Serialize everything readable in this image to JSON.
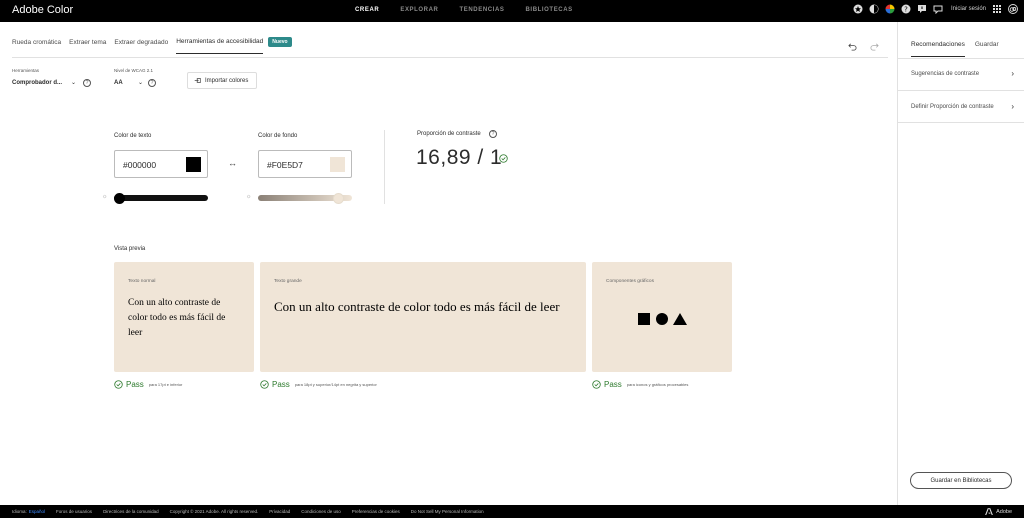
{
  "app": {
    "title": "Adobe Color"
  },
  "topnav": {
    "items": [
      "CREAR",
      "EXPLORAR",
      "TENDENCIAS",
      "BIBLIOTECAS"
    ]
  },
  "topbar_right": {
    "signin": "Iniciar sesión"
  },
  "subtabs": {
    "items": [
      "Rueda cromática",
      "Extraer tema",
      "Extraer degradado",
      "Herramientas de accesibilidad"
    ],
    "badge": "Nuevo"
  },
  "controls": {
    "tool_label": "Herramientas",
    "tool_value": "Comprobador d...",
    "wcag_label": "Nivel de WCAG 2.1",
    "wcag_value": "AA",
    "import_label": "Importar colores"
  },
  "contrast": {
    "text_color_label": "Color de texto",
    "text_color_value": "#000000",
    "background_label": "Color de fondo",
    "background_value": "#F0E5D7",
    "ratio_label": "Proporción de contraste",
    "ratio_value": "16,89 / 1",
    "text_slider_level": 0.0,
    "background_slider_level": 0.9
  },
  "preview": {
    "label": "Vista previa",
    "cards": [
      {
        "title": "Texto normal",
        "text": "Con un alto contraste de color todo es más fácil de leer",
        "pass": "Pass",
        "note": "para 17pt e inferior"
      },
      {
        "title": "Texto grande",
        "text": "Con un alto contraste de color todo es más fácil de leer",
        "pass": "Pass",
        "note": "para 18pt y superior/14pt en negrita y superior"
      },
      {
        "title": "Componentes gráficos",
        "pass": "Pass",
        "note": "para iconos y gráficos procesables"
      }
    ]
  },
  "right_panel": {
    "tabs": [
      "Recomendaciones",
      "Guardar"
    ],
    "items": [
      "Sugerencias de contraste",
      "Definir Proporción de contraste"
    ],
    "save_button": "Guardar en Bibliotecas"
  },
  "footer": {
    "language_label": "Idioma:",
    "language_value": "Español",
    "links": [
      "Foros de usuarios",
      "Directrices de la comunidad",
      "Copyright © 2021 Adobe. All rights reserved.",
      "Privacidad",
      "Condiciones de uso",
      "Preferencias de cookies",
      "Do Not Sell My Personal Information"
    ],
    "brand": "Adobe"
  },
  "colors": {
    "text": "#000000",
    "background": "#F0E5D7",
    "accent": "#2d8a8a",
    "pass": "#2d7a2d"
  },
  "icons": [
    "undo-icon",
    "redo-icon",
    "help-icon",
    "import-icon",
    "swap-icon",
    "check-circle-icon",
    "square-icon",
    "circle-icon",
    "triangle-icon",
    "chevron-right-icon",
    "brightness-icon",
    "app-grid-icon",
    "creative-cloud-icon"
  ]
}
